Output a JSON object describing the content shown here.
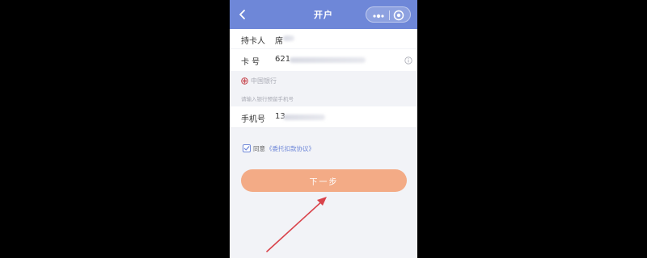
{
  "header": {
    "title": "开户",
    "back_icon": "chevron-left-icon",
    "more_icon": "more-dots-icon",
    "close_icon": "target-close-icon",
    "color": "#6e87d8"
  },
  "form": {
    "holder": {
      "label": "持卡人",
      "value": "席"
    },
    "card": {
      "label": "卡 号",
      "value": "621",
      "info_icon": "info-icon"
    },
    "bank": {
      "icon": "bank-logo-icon",
      "name": "中国银行"
    },
    "phone_hint": "请输入银行预留手机号",
    "phone": {
      "label": "手机号",
      "value": "13"
    }
  },
  "agreement": {
    "checked": true,
    "text": "同意",
    "link": "《委托扣款协议》"
  },
  "next_button": {
    "label": "下一步",
    "color": "#f3ab86"
  },
  "annotation": {
    "arrow_color": "#d9434b"
  }
}
